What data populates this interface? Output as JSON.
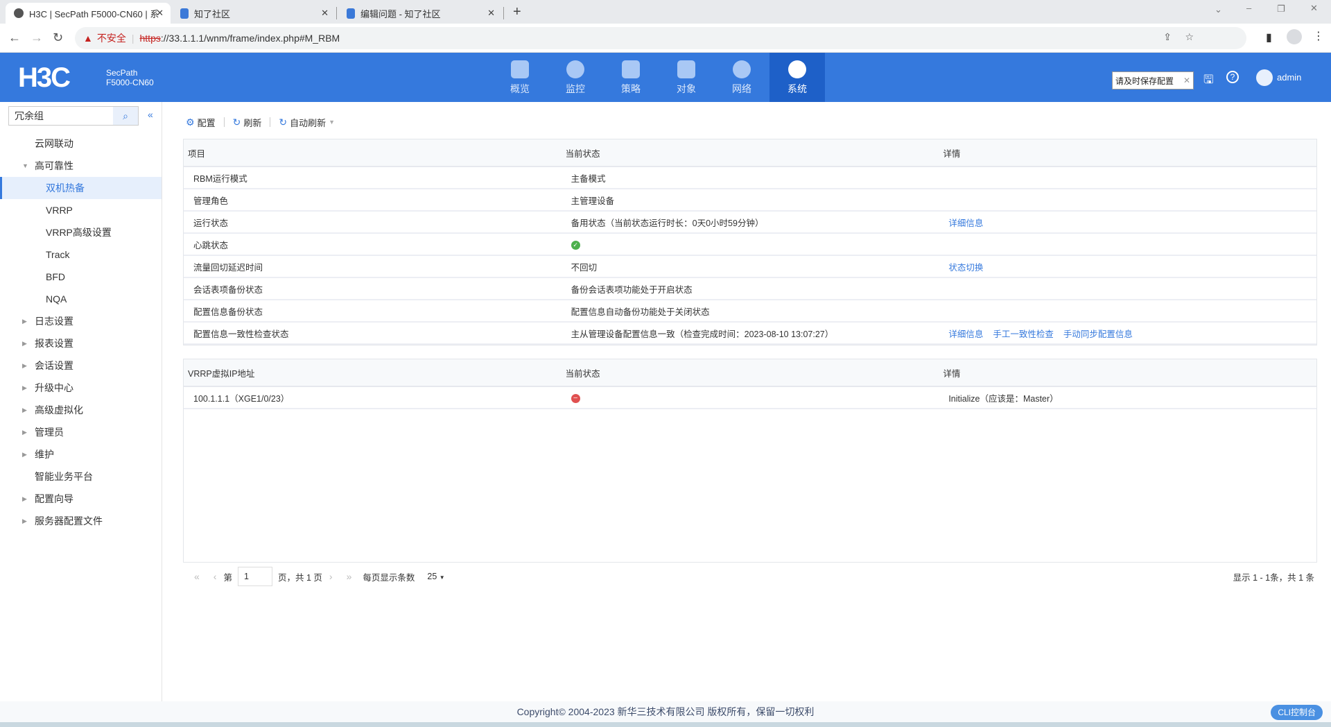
{
  "browser": {
    "tabs": [
      {
        "title": "H3C | SecPath F5000-CN60 | 系",
        "close": "✕"
      },
      {
        "title": "知了社区",
        "close": "✕"
      },
      {
        "title": "编辑问题 - 知了社区",
        "close": "✕"
      }
    ],
    "new_tab": "+",
    "security_label": "不安全",
    "url_scheme": "https",
    "url_rest": "://33.1.1.1/wnm/frame/index.php#M_RBM"
  },
  "header": {
    "logo": "H3C",
    "model_line1": "SecPath",
    "model_line2": "F5000-CN60",
    "menu": [
      {
        "label": "概览",
        "icon": "dashboard-icon"
      },
      {
        "label": "监控",
        "icon": "monitor-icon"
      },
      {
        "label": "策略",
        "icon": "shield-icon"
      },
      {
        "label": "对象",
        "icon": "objects-icon"
      },
      {
        "label": "网络",
        "icon": "globe-icon"
      },
      {
        "label": "系统",
        "icon": "gear-icon",
        "active": true
      }
    ],
    "save_tip": "请及时保存配置",
    "user": "admin"
  },
  "sidebar": {
    "search_value": "冗余组",
    "items": [
      {
        "label": "云网联动",
        "level": 1
      },
      {
        "label": "高可靠性",
        "level": 1,
        "expanded": true
      },
      {
        "label": "双机热备",
        "level": 2,
        "selected": true
      },
      {
        "label": "VRRP",
        "level": 2
      },
      {
        "label": "VRRP高级设置",
        "level": 2
      },
      {
        "label": "Track",
        "level": 2
      },
      {
        "label": "BFD",
        "level": 2
      },
      {
        "label": "NQA",
        "level": 2
      },
      {
        "label": "日志设置",
        "level": 1,
        "caret": true
      },
      {
        "label": "报表设置",
        "level": 1,
        "caret": true
      },
      {
        "label": "会话设置",
        "level": 1,
        "caret": true
      },
      {
        "label": "升级中心",
        "level": 1,
        "caret": true
      },
      {
        "label": "高级虚拟化",
        "level": 1,
        "caret": true
      },
      {
        "label": "管理员",
        "level": 1,
        "caret": true
      },
      {
        "label": "维护",
        "level": 1,
        "caret": true
      },
      {
        "label": "智能业务平台",
        "level": 1
      },
      {
        "label": "配置向导",
        "level": 1,
        "caret": true
      },
      {
        "label": "服务器配置文件",
        "level": 1,
        "caret": true
      }
    ]
  },
  "toolbar": {
    "config": "配置",
    "refresh": "刷新",
    "auto_refresh": "自动刷新"
  },
  "rbm_table": {
    "headers": [
      "项目",
      "当前状态",
      "详情"
    ],
    "rows": [
      {
        "item": "RBM运行模式",
        "status": "主备模式",
        "links": []
      },
      {
        "item": "管理角色",
        "status": "主管理设备",
        "links": []
      },
      {
        "item": "运行状态",
        "status": "备用状态（当前状态运行时长：0天0小时59分钟）",
        "links": [
          "详细信息"
        ]
      },
      {
        "item": "心跳状态",
        "status": "",
        "status_icon": "ok",
        "links": []
      },
      {
        "item": "流量回切延迟时间",
        "status": "不回切",
        "links": [
          "状态切换"
        ]
      },
      {
        "item": "会话表项备份状态",
        "status": "备份会话表项功能处于开启状态",
        "links": []
      },
      {
        "item": "配置信息备份状态",
        "status": "配置信息自动备份功能处于关闭状态",
        "links": []
      },
      {
        "item": "配置信息一致性检查状态",
        "status": "主从管理设备配置信息一致（检查完成时间：2023-08-10 13:07:27）",
        "links": [
          "详细信息",
          "手工一致性检查",
          "手动同步配置信息"
        ]
      }
    ]
  },
  "vrrp_table": {
    "headers": [
      "VRRP虚拟IP地址",
      "当前状态",
      "详情"
    ],
    "rows": [
      {
        "ip": "100.1.1.1（XGE1/0/23）",
        "status_icon": "error",
        "detail": "Initialize（应该是：Master）"
      }
    ]
  },
  "pager": {
    "page_prefix": "第",
    "page": "1",
    "page_suffix": "页，共 1 页",
    "per_page_label": "每页显示条数",
    "per_page": "25",
    "summary": "显示 1 - 1条，共 1 条"
  },
  "footer": {
    "copyright": "Copyright© 2004-2023 新华三技术有限公司 版权所有，保留一切权利",
    "cli": "CLI控制台"
  }
}
